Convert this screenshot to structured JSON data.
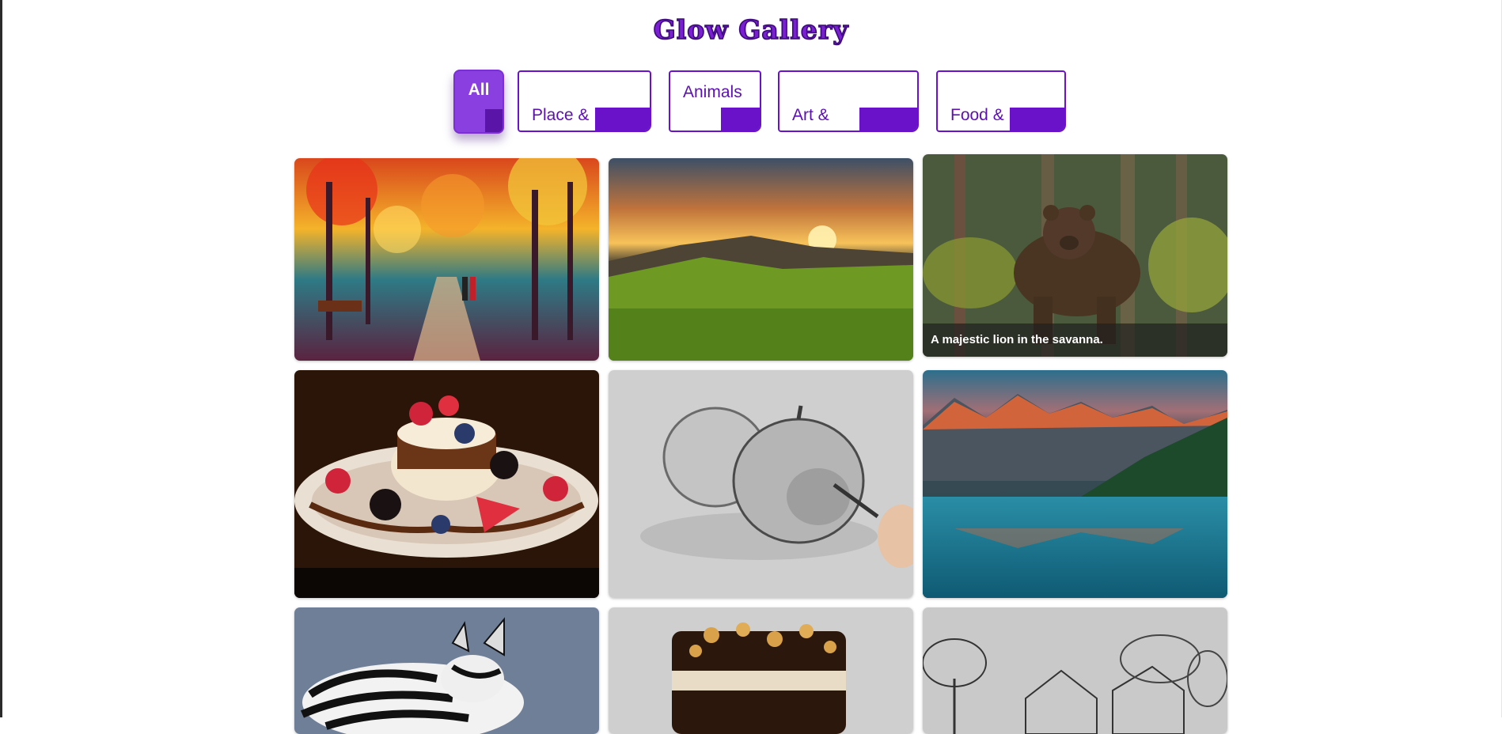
{
  "gallery": {
    "title": "Glow Gallery",
    "accent_color": "#6a12c9",
    "filters": [
      {
        "label": "All",
        "active": true
      },
      {
        "label": "Place &\nTravel",
        "active": false
      },
      {
        "label": "Animals",
        "active": false
      },
      {
        "label": "Art &\nCreativity",
        "active": false
      },
      {
        "label": "Food &\nDrinks",
        "active": false
      }
    ],
    "images": [
      {
        "subject": "impressionist painting of rainy autumn park with couple"
      },
      {
        "subject": "sunset over grassy mountain hills"
      },
      {
        "subject": "brown bear standing in forest",
        "caption": "A majestic lion in the savanna."
      },
      {
        "subject": "dessert with chocolate drizzle and berries"
      },
      {
        "subject": "pencil sketch of two apples"
      },
      {
        "subject": "mountain lake reflecting red peaks"
      },
      {
        "subject": "zebra in grassland"
      },
      {
        "subject": "chocolate layer cake with nuts"
      },
      {
        "subject": "pencil sketch of a house among trees"
      }
    ]
  }
}
